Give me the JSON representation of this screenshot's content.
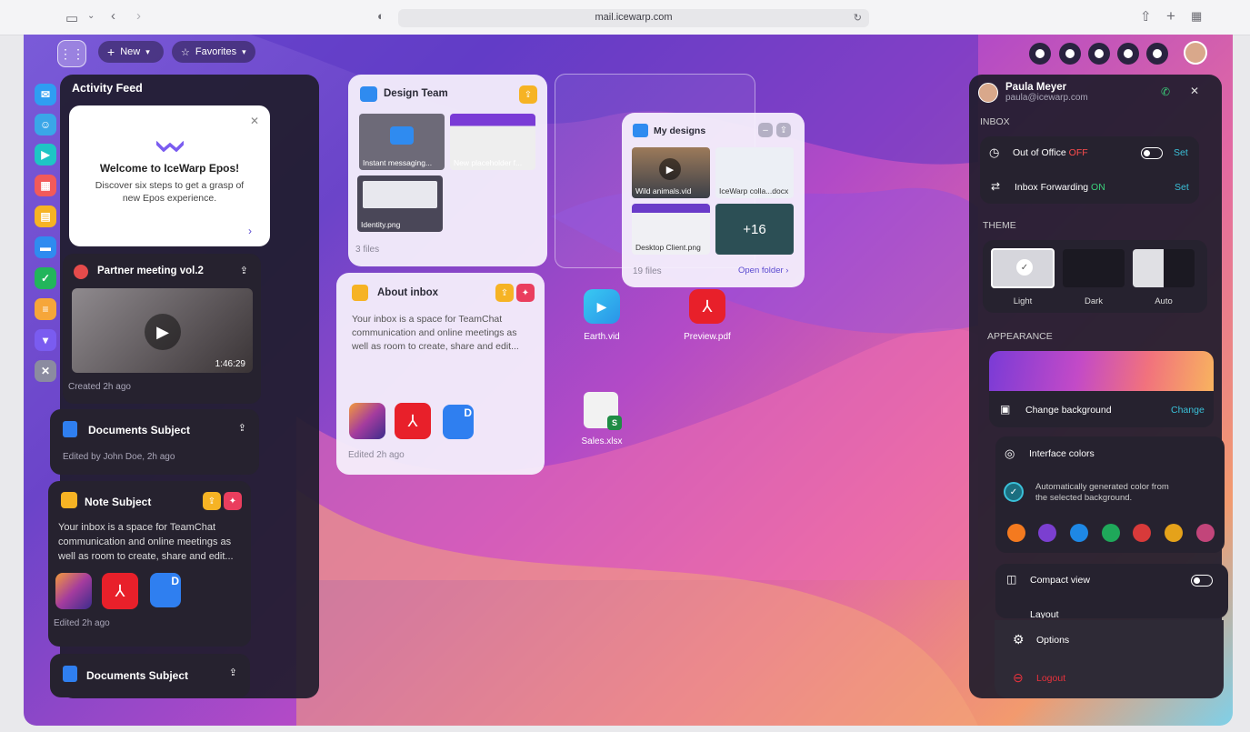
{
  "browser": {
    "url": "mail.icewarp.com"
  },
  "toolbar": {
    "new_label": "New",
    "favorites_label": "Favorites"
  },
  "activity": {
    "title": "Activity Feed",
    "welcome": {
      "title": "Welcome to IceWarp Epos!",
      "body_line1": "Discover six steps to get a grasp of",
      "body_line2": "new Epos experience."
    },
    "meeting": {
      "title": "Partner meeting vol.2",
      "duration": "1:46:29",
      "created": "Created 2h ago"
    },
    "doc1": {
      "title": "Documents Subject",
      "edited": "Edited by John Doe, 2h ago"
    },
    "note": {
      "title": "Note Subject",
      "line1": "Your inbox is a space for TeamChat",
      "line2": "communication and online meetings as",
      "line3": "well as room to create, share and edit...",
      "edited": "Edited 2h ago"
    },
    "doc2": {
      "title": "Documents Subject"
    }
  },
  "design_team": {
    "title": "Design Team",
    "files": [
      "Instant messaging...",
      "New placeholder f...",
      "Identity.png"
    ],
    "count": "3 files"
  },
  "about_inbox": {
    "title": "About inbox",
    "line1": "Your inbox is a space for TeamChat",
    "line2": "communication and online meetings as",
    "line3": "well as room to create, share and edit...",
    "edited": "Edited 2h ago"
  },
  "my_designs": {
    "title": "My designs",
    "files": [
      "Wild animals.vid",
      "IceWarp colla...docx",
      "Desktop Client.png"
    ],
    "more": "+16",
    "count": "19 files",
    "open": "Open folder"
  },
  "desktop_files": {
    "earth": "Earth.vid",
    "preview": "Preview.pdf",
    "sales": "Sales.xlsx"
  },
  "profile": {
    "name": "Paula Meyer",
    "email": "paula@icewarp.com",
    "inbox_label": "INBOX",
    "ooo_label": "Out of Office",
    "ooo_state": "OFF",
    "ooo_action": "Set",
    "fwd_label": "Inbox Forwarding",
    "fwd_state": "ON",
    "fwd_action": "Set",
    "theme_label": "THEME",
    "themes": [
      "Light",
      "Dark",
      "Auto"
    ],
    "appearance_label": "APPEARANCE",
    "bg_label": "Change background",
    "bg_action": "Change",
    "colors_label": "Interface colors",
    "colors_desc1": "Automatically generated color from",
    "colors_desc2": "the selected background.",
    "swatches": [
      "#f47a1f",
      "#7b3fd0",
      "#1e88e5",
      "#1fa85a",
      "#d83a3a",
      "#e5a21a",
      "#c2457a"
    ],
    "compact_label": "Compact view",
    "layout_label": "Layout",
    "options_label": "Options",
    "logout_label": "Logout"
  },
  "colors": {
    "accent": "#7c5cf0",
    "teal": "#3ac0d8",
    "red": "#ff4d4d",
    "green": "#3ad17a"
  }
}
